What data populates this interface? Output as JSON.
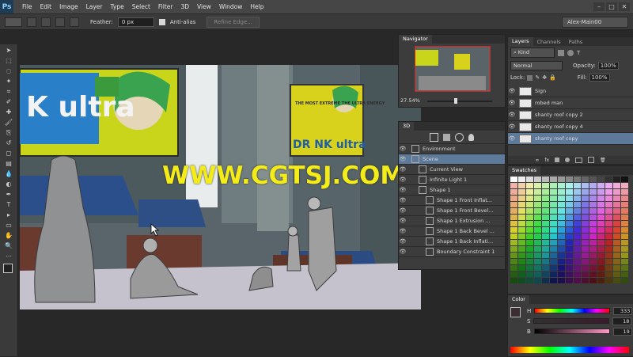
{
  "menu": {
    "logo": "Ps",
    "items": [
      "File",
      "Edit",
      "Image",
      "Layer",
      "Type",
      "Select",
      "Filter",
      "3D",
      "View",
      "Window",
      "Help"
    ],
    "window_controls": [
      "–",
      "□",
      "✕"
    ]
  },
  "options": {
    "feather_label": "Feather:",
    "feather_value": "0 px",
    "antialias_label": "Anti-alias",
    "refine_edge_label": "Refine Edge...",
    "workspace": "Alex-Main00"
  },
  "tools": [
    "selection-tool",
    "marquee-tool",
    "lasso-tool",
    "quick-select-tool",
    "crop-tool",
    "eyedropper-tool",
    "healing-tool",
    "brush-tool",
    "clone-stamp-tool",
    "history-brush-tool",
    "eraser-tool",
    "gradient-tool",
    "blur-tool",
    "dodge-tool",
    "pen-tool",
    "type-tool",
    "path-select-tool",
    "shape-tool",
    "hand-tool",
    "zoom-tool",
    "edit-toolbar"
  ],
  "canvas": {
    "watermark": "WWW.CGTSJ.COM",
    "billboard1_text": "K ultra",
    "billboard2_text": "THE MOST EXTREME THE ULTRA ENERGY",
    "billboard2_logo": "DR NK ultra"
  },
  "navigator": {
    "title": "Navigator",
    "zoom": "27.54%"
  },
  "panel3d": {
    "title": "3D",
    "rows": [
      {
        "label": "Environment",
        "indent": 0
      },
      {
        "label": "Scene",
        "indent": 0
      },
      {
        "label": "Current View",
        "indent": 1
      },
      {
        "label": "Infinite Light 1",
        "indent": 1
      },
      {
        "label": "Shape 1",
        "indent": 1
      },
      {
        "label": "Shape 1 Front Inflat...",
        "indent": 2
      },
      {
        "label": "Shape 1 Front Bevel...",
        "indent": 2
      },
      {
        "label": "Shape 1 Extrusion ...",
        "indent": 2
      },
      {
        "label": "Shape 1 Back Bevel ...",
        "indent": 2
      },
      {
        "label": "Shape 1 Back Inflati...",
        "indent": 2
      },
      {
        "label": "Boundary Constraint 1",
        "indent": 2
      }
    ]
  },
  "layers": {
    "tabs": [
      "Layers",
      "Channels",
      "Paths"
    ],
    "kind": "Kind",
    "blend_mode": "Normal",
    "opacity_label": "Opacity:",
    "opacity_value": "100%",
    "lock_label": "Lock:",
    "fill_label": "Fill:",
    "fill_value": "100%",
    "items": [
      "Sign",
      "robed man",
      "shanty roof copy 2",
      "shanty roof copy 4",
      "shanty roof copy"
    ],
    "selected_index": 4
  },
  "swatches": {
    "title": "Swatches"
  },
  "color": {
    "title": "Color",
    "h_label": "H",
    "h_value": "333",
    "h_unit": "",
    "s_label": "S",
    "s_value": "18",
    "s_unit": "%",
    "b_label": "B",
    "b_value": "19",
    "b_unit": "%"
  }
}
